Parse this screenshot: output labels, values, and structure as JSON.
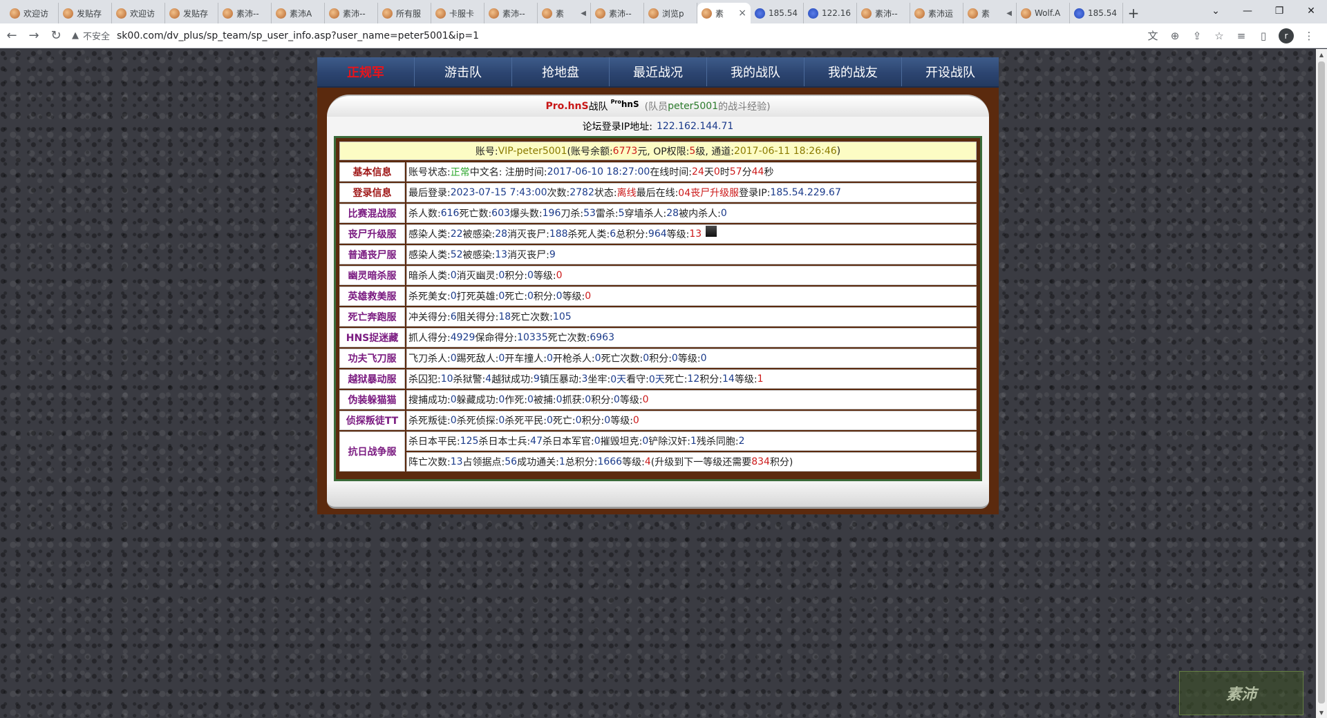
{
  "browser": {
    "tabs": [
      {
        "label": "欢迎访",
        "icon": "site-favicon"
      },
      {
        "label": "发贴存",
        "icon": "site-favicon"
      },
      {
        "label": "欢迎访",
        "icon": "site-favicon"
      },
      {
        "label": "发贴存",
        "icon": "site-favicon"
      },
      {
        "label": "素沛--",
        "icon": "site-favicon"
      },
      {
        "label": "素沛A",
        "icon": "site-favicon"
      },
      {
        "label": "素沛--",
        "icon": "site-favicon"
      },
      {
        "label": "所有服",
        "icon": "site-favicon"
      },
      {
        "label": "卡服卡",
        "icon": "site-favicon"
      },
      {
        "label": "素沛--",
        "icon": "site-favicon"
      },
      {
        "label": "素",
        "icon": "site-favicon",
        "audio": true
      },
      {
        "label": "素沛--",
        "icon": "site-favicon"
      },
      {
        "label": "浏览p",
        "icon": "site-favicon"
      },
      {
        "label": "素",
        "icon": "site-favicon",
        "active": true
      },
      {
        "label": "185.54",
        "icon": "paw-favicon"
      },
      {
        "label": "122.16",
        "icon": "paw-favicon"
      },
      {
        "label": "素沛--",
        "icon": "site-favicon"
      },
      {
        "label": "素沛运",
        "icon": "site-favicon"
      },
      {
        "label": "素",
        "icon": "site-favicon",
        "audio": true
      },
      {
        "label": "Wolf.A",
        "icon": "site-favicon"
      },
      {
        "label": "185.54",
        "icon": "paw-favicon"
      }
    ],
    "insecure_label": "不安全",
    "url": "sk00.com/dv_plus/sp_team/sp_user_info.asp?user_name=peter5001&ip=1",
    "profile_initial": "r"
  },
  "nav": {
    "items": [
      "正规军",
      "游击队",
      "抢地盘",
      "最近战况",
      "我的战队",
      "我的战友",
      "开设战队"
    ]
  },
  "header": {
    "team_name": "Pro.hnS",
    "team_suffix": "战队",
    "logo_sup": "Pro",
    "logo_text": "hnS",
    "member_prefix": "(队员",
    "member_name": "peter5001",
    "member_suffix": "的战斗经验)"
  },
  "ip": {
    "label": "论坛登录IP地址:",
    "value": "122.162.144.71"
  },
  "account": {
    "l1": "账号:",
    "name": "VIP-peter5001",
    "l2": "(账号余额:",
    "balance": "6773",
    "l3": "元, OP权限:",
    "op": "5",
    "l4": "级, 通道:",
    "date": "2017-06-11 18:26:46",
    "l5": ")"
  },
  "rows": {
    "basic": {
      "label": "基本信息",
      "c1": "账号状态:",
      "status": "正常",
      "c2": " 中文名:  注册时间:",
      "reg": "2017-06-10 18:27:00",
      "c3": " 在线时间:",
      "d": "24",
      "c4": "天",
      "h": "0",
      "c5": "时",
      "m": "57",
      "c6": "分",
      "s": "44",
      "c7": "秒"
    },
    "login": {
      "label": "登录信息",
      "c1": "最后登录:",
      "last": "2023-07-15 7:43:00",
      "c2": " 次数:",
      "count": "2782",
      "c3": " 状态:",
      "state": "离线",
      "c4": " 最后在线:",
      "server": "04丧尸升级服",
      "c5": " 登录IP:",
      "ip": "185.54.229.67"
    },
    "mixed": {
      "label": "比赛混战服",
      "c1": "杀人数:",
      "kills": "616",
      "c2": " 死亡数:",
      "deaths": "603",
      "c3": " 爆头数:",
      "hs": "196",
      "c4": " 刀杀:",
      "knife": "53",
      "c5": " 雷杀:",
      "nade": "5",
      "c6": " 穿墙杀人:",
      "wall": "28",
      "c7": " 被内杀人:",
      "tk": "0"
    },
    "zombie_up": {
      "label": "丧尸升级服",
      "c1": "感染人类:",
      "inf": "22",
      "c2": " 被感染:",
      "infd": "28",
      "c3": " 消灭丧尸:",
      "zk": "188",
      "c4": " 杀死人类:",
      "hk": "6",
      "c5": " 总积分:",
      "pts": "964",
      "c6": " 等级:",
      "lvl": "13"
    },
    "zombie": {
      "label": "普通丧尸服",
      "c1": "感染人类:",
      "inf": "52",
      "c2": " 被感染:",
      "infd": "13",
      "c3": " 消灭丧尸:",
      "zk": "9"
    },
    "ghost": {
      "label": "幽灵暗杀服",
      "c1": "暗杀人类:",
      "a": "0",
      "c2": " 消灭幽灵:",
      "b": "0",
      "c3": " 积分:",
      "c": "0",
      "c4": " 等级:",
      "d": "0"
    },
    "hero": {
      "label": "英雄救美服",
      "c1": "杀死美女:",
      "a": "0",
      "c2": " 打死英雄:",
      "b": "0",
      "c3": " 死亡:",
      "c": "0",
      "c4": " 积分:",
      "d": "0",
      "c5": " 等级:",
      "e": "0"
    },
    "deathrun": {
      "label": "死亡奔跑服",
      "c1": "冲关得分:",
      "a": "6",
      "c2": " 阻关得分:",
      "b": "18",
      "c3": " 死亡次数:",
      "c": "105"
    },
    "hns": {
      "label": "HNS捉迷藏",
      "c1": "抓人得分:",
      "a": "4929",
      "c2": " 保命得分:",
      "b": "10335",
      "c3": " 死亡次数:",
      "c": "6963"
    },
    "kungfu": {
      "label": "功夫飞刀服",
      "c1": "飞刀杀人:",
      "a": "0",
      "c2": " 踢死敌人:",
      "b": "0",
      "c3": " 开车撞人:",
      "c": "0",
      "c4": " 开枪杀人:",
      "d": "0",
      "c5": " 死亡次数:",
      "e": "0",
      "c6": " 积分:",
      "f": "0",
      "c7": " 等级:",
      "g": "0"
    },
    "jail": {
      "label": "越狱暴动服",
      "c1": "杀囚犯:",
      "a": "10",
      "c2": " 杀狱警:",
      "b": "4",
      "c3": " 越狱成功:",
      "c": "9",
      "c4": " 镇压暴动:",
      "d": "3",
      "c5": " 坐牢:",
      "e": "0天",
      "c6": " 看守:",
      "f": "0天",
      "c7": " 死亡:",
      "g": "12",
      "c8": " 积分:",
      "h": "14",
      "c9": " 等级:",
      "i": "1"
    },
    "prop": {
      "label": "伪装躲猫猫",
      "c1": "搜捕成功:",
      "a": "0",
      "c2": " 躲藏成功:",
      "b": "0",
      "c3": " 作死:",
      "c": "0",
      "c4": " 被捕:",
      "d": "0",
      "c5": " 抓获:",
      "e": "0",
      "c6": " 积分:",
      "f": "0",
      "c7": " 等级:",
      "g": "0"
    },
    "detective": {
      "label": "侦探叛徒TT",
      "c1": "杀死叛徒:",
      "a": "0",
      "c2": " 杀死侦探:",
      "b": "0",
      "c3": " 杀死平民:",
      "c": "0",
      "c4": " 死亡:",
      "d": "0",
      "c5": " 积分:",
      "e": "0",
      "c6": " 等级:",
      "f": "0"
    },
    "war": {
      "label": "抗日战争服",
      "l1": {
        "c1": "杀日本平民:",
        "a": "125",
        "c2": " 杀日本士兵:",
        "b": "47",
        "c3": " 杀日本军官:",
        "c": "0",
        "c4": " 摧毁坦克:",
        "d": "0",
        "c5": " 铲除汉奸:",
        "e": "1",
        "c6": " 残杀同胞:",
        "f": "2"
      },
      "l2": {
        "c1": "阵亡次数:",
        "a": "13",
        "c2": " 占领据点:",
        "b": "56",
        "c3": " 成功通关:",
        "c": "1",
        "c4": " 总积分:",
        "d": "1666",
        "c5": " 等级:",
        "e": "4",
        "c6": " (升级到下一等级还需要",
        "f": "834",
        "c7": "积分)"
      }
    }
  },
  "watermark": "素沛"
}
